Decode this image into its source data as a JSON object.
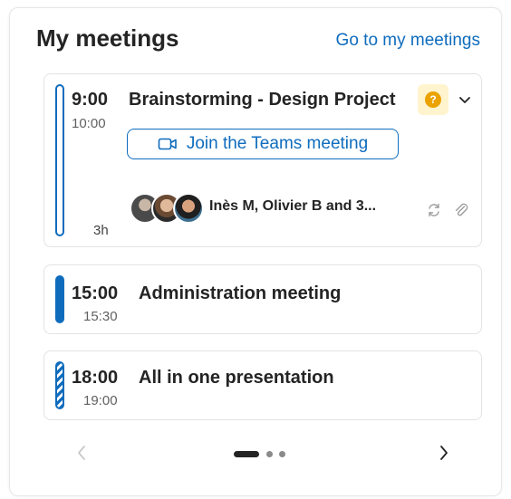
{
  "header": {
    "title": "My meetings",
    "link": "Go to my meetings"
  },
  "meetings": [
    {
      "start": "9:00",
      "end": "10:00",
      "title": "Brainstorming - Design Project",
      "status_icon": "question-mark",
      "status_glyph": "?",
      "join_label": "Join the Teams meeting",
      "attendees": "Inès M, Olivier B and 3...",
      "duration": "3h",
      "bar_style": "outline"
    },
    {
      "start": "15:00",
      "end": "15:30",
      "title": "Administration meeting",
      "bar_style": "solid"
    },
    {
      "start": "18:00",
      "end": "19:00",
      "title": "All in one presentation",
      "bar_style": "striped"
    }
  ],
  "pagination": {
    "pages": 3,
    "current": 1
  },
  "colors": {
    "accent": "#0f6cbd",
    "status_bg": "#fff4ce",
    "status_dot": "#eaa300",
    "text": "#242424",
    "muted": "#616161"
  }
}
